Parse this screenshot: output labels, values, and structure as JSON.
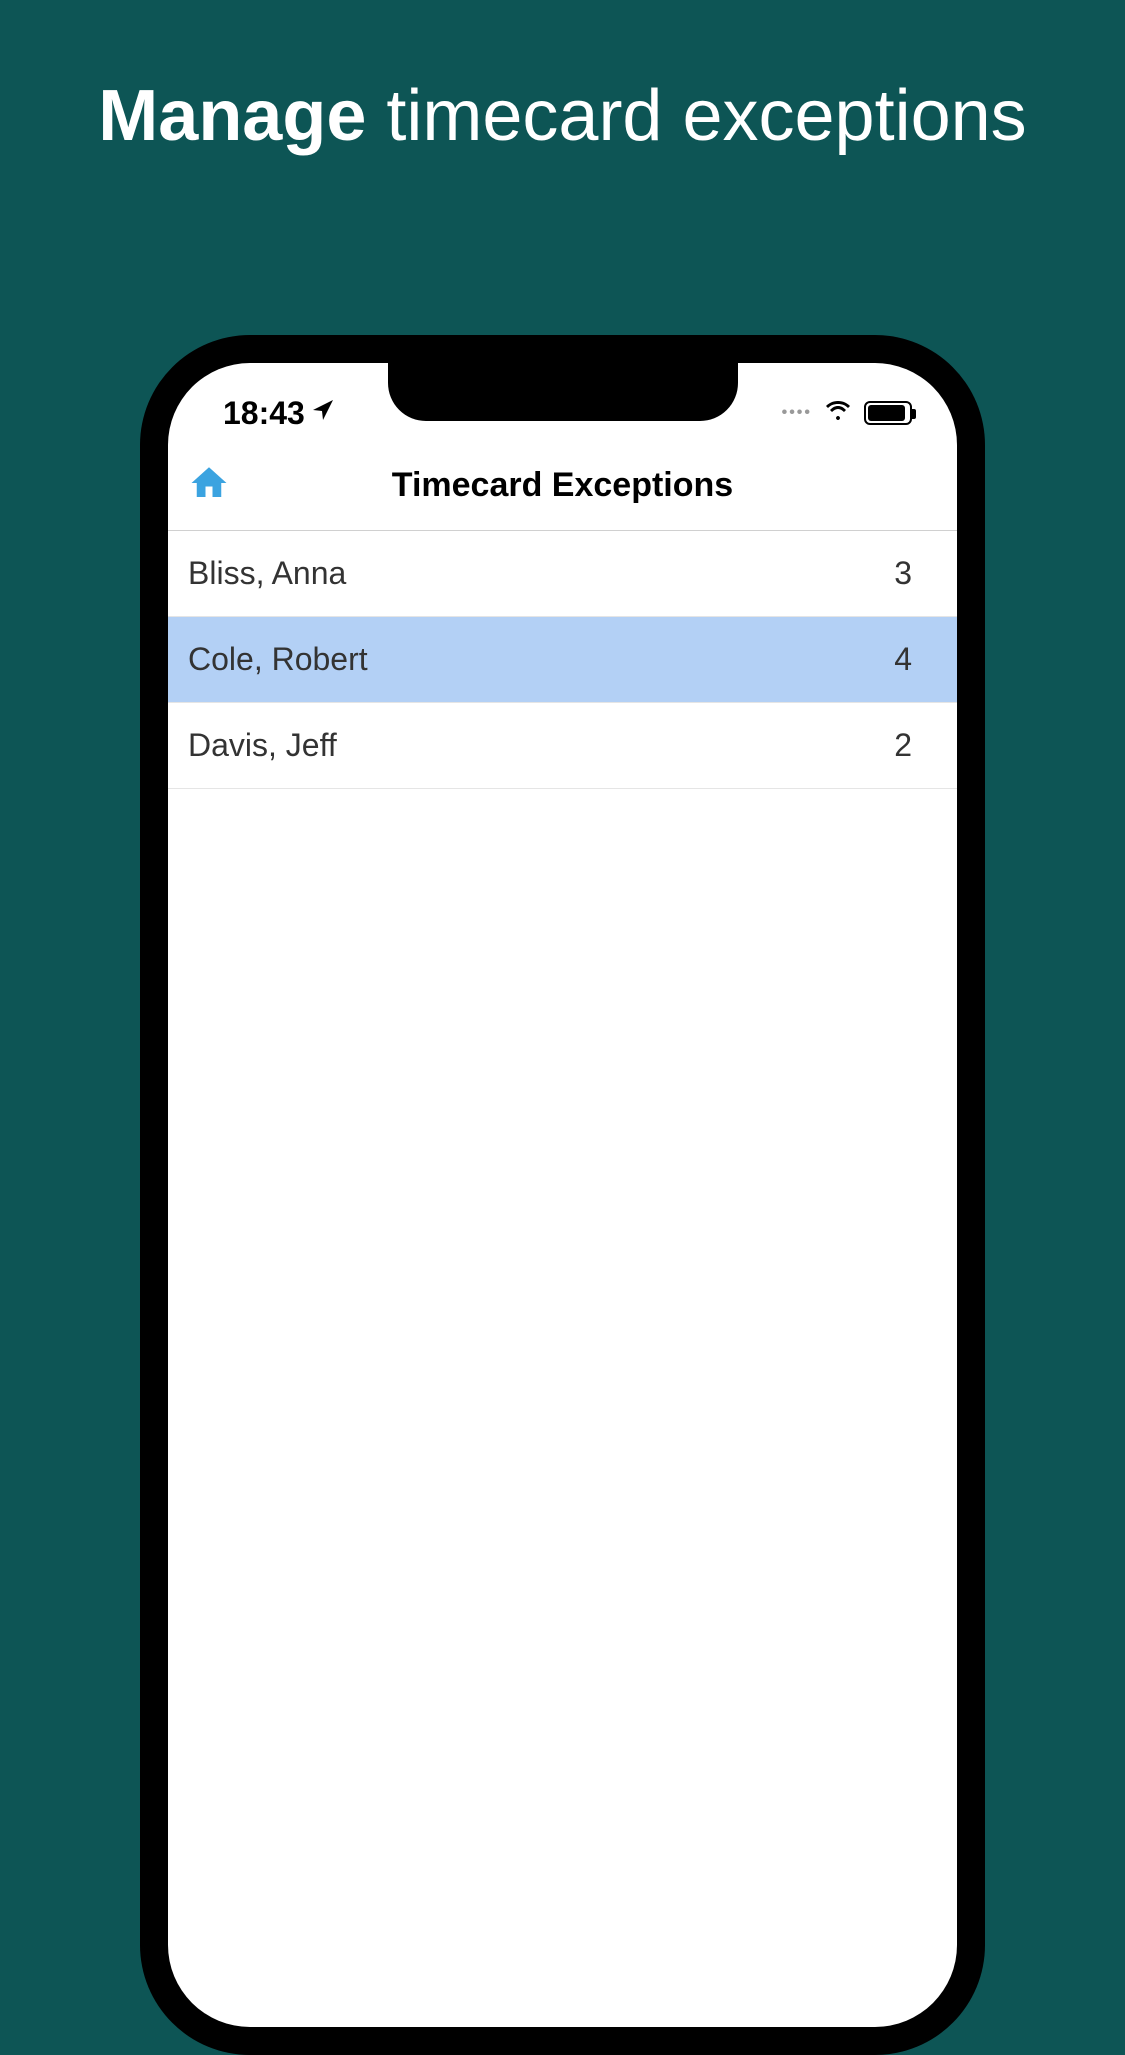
{
  "promo": {
    "title_bold": "Manage",
    "title_rest": " timecard exceptions"
  },
  "status_bar": {
    "time": "18:43"
  },
  "nav": {
    "title": "Timecard Exceptions"
  },
  "list": {
    "items": [
      {
        "name": "Bliss, Anna",
        "count": "3",
        "selected": false
      },
      {
        "name": "Cole, Robert",
        "count": "4",
        "selected": true
      },
      {
        "name": "Davis, Jeff",
        "count": "2",
        "selected": false
      }
    ]
  }
}
